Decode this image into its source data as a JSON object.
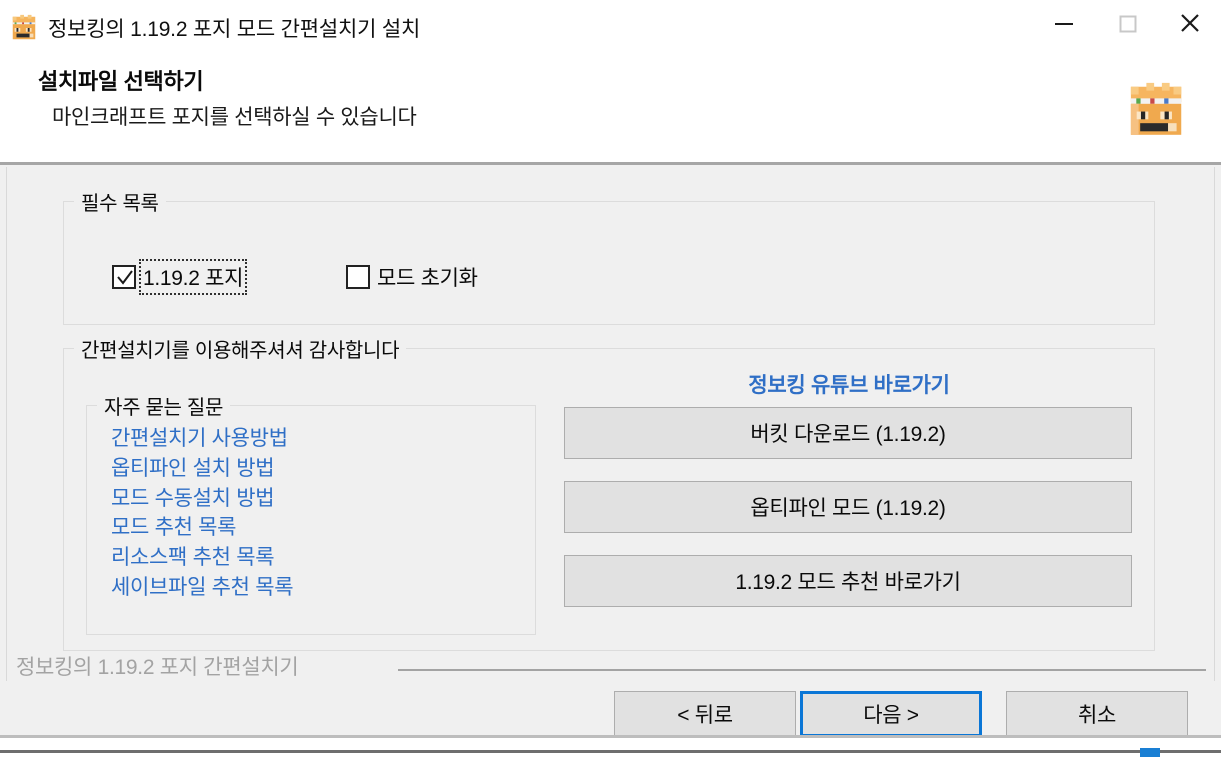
{
  "window": {
    "title": "정보킹의 1.19.2 포지 모드 간편설치기 설치",
    "app_icon": "minecraft-king-head-icon",
    "caption": {
      "minimize_label": "minimize-icon",
      "maximize_label": "maximize-icon",
      "close_label": "close-icon"
    }
  },
  "header": {
    "title": "설치파일 선택하기",
    "subtitle": "마인크래프트 포지를 선택하실 수 있습니다",
    "logo": "minecraft-king-head-logo"
  },
  "required_group": {
    "legend": "필수 목록",
    "checkboxes": [
      {
        "label": "1.19.2 포지",
        "checked": true,
        "focused": true
      },
      {
        "label": "모드 초기화",
        "checked": false,
        "focused": false
      }
    ]
  },
  "thanks_group": {
    "legend": "간편설치기를 이용해주셔셔 감사합니다",
    "faq": {
      "legend": "자주 묻는 질문",
      "links": [
        "간편설치기 사용방법",
        "옵티파인 설치 방법",
        "모드 수동설치 방법",
        "모드 추천 목록",
        "리소스팩 추천 목록",
        "세이브파일 추천 목록"
      ]
    },
    "youtube_link": "정보킹 유튜브 바로가기",
    "action_buttons": [
      "버킷 다운로드 (1.19.2)",
      "옵티파인 모드 (1.19.2)",
      "1.19.2 모드 추천 바로가기"
    ]
  },
  "footer": {
    "brand": "정보킹의 1.19.2 포지 간편설치기",
    "nav": {
      "back": "< 뒤로",
      "next": "다음 >",
      "cancel": "취소"
    }
  },
  "colors": {
    "link_blue": "#2f6fc6",
    "focus_blue": "#0a76d6",
    "window_bg": "#f0f0f0",
    "button_bg": "#e1e1e1",
    "button_border": "#adadad",
    "footer_text": "#a3a3a3"
  }
}
